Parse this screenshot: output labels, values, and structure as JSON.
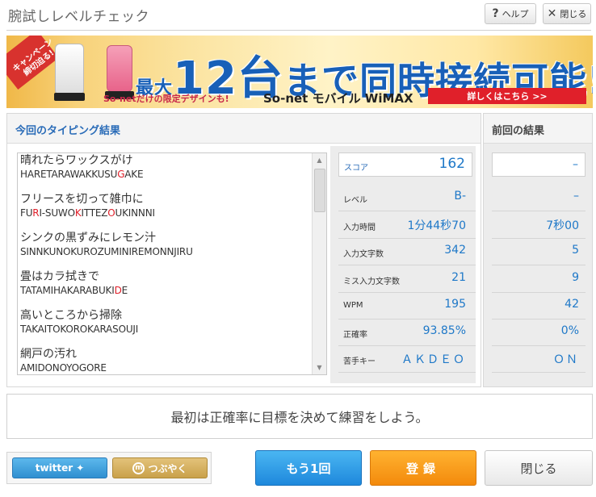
{
  "header": {
    "title": "腕試しレベルチェック",
    "help_label": "ヘルプ",
    "close_label": "閉じる"
  },
  "banner": {
    "ribbon": "キャンペーン 締切迫る!",
    "headline_pre": "最大",
    "headline_num": "12台",
    "headline_post": "まで同時接続可能!!",
    "sub": "So-netだけの限定デザインも!",
    "brand": "So-net モバイル WiMAX",
    "cta": "詳しくはこちら >>"
  },
  "current": {
    "title": "今回のタイピング結果",
    "lines": [
      {
        "jp": "晴れたらワックスがけ",
        "romaji_parts": [
          {
            "t": "HARETARAWAKKUSU",
            "err": false
          },
          {
            "t": "G",
            "err": true
          },
          {
            "t": "AKE",
            "err": false
          }
        ]
      },
      {
        "jp": "フリースを切って雑巾に",
        "romaji_parts": [
          {
            "t": "FU",
            "err": false
          },
          {
            "t": "R",
            "err": true
          },
          {
            "t": "I-SUWO",
            "err": false
          },
          {
            "t": "K",
            "err": true
          },
          {
            "t": "ITTEZ",
            "err": false
          },
          {
            "t": "O",
            "err": true
          },
          {
            "t": "UKINNNI",
            "err": false
          }
        ]
      },
      {
        "jp": "シンクの黒ずみにレモン汁",
        "romaji_parts": [
          {
            "t": "SINNKUNOKUROZUMINIREMONNJIRU",
            "err": false
          }
        ]
      },
      {
        "jp": "畳はカラ拭きで",
        "romaji_parts": [
          {
            "t": "TATAMIHAKARABUKI",
            "err": false
          },
          {
            "t": "D",
            "err": true
          },
          {
            "t": "E",
            "err": false
          }
        ]
      },
      {
        "jp": "高いところから掃除",
        "romaji_parts": [
          {
            "t": "TAKAITOKOROKARASOUJI",
            "err": false
          }
        ]
      },
      {
        "jp": "網戸の汚れ",
        "romaji_parts": [
          {
            "t": "AMIDONOYOGORE",
            "err": false
          }
        ]
      }
    ],
    "stats": {
      "score_label": "スコア",
      "score": "162",
      "level_label": "レベル",
      "level": "B-",
      "time_label": "入力時間",
      "time": "1分44秒70",
      "chars_label": "入力文字数",
      "chars": "342",
      "miss_label": "ミス入力文字数",
      "miss": "21",
      "wpm_label": "WPM",
      "wpm": "195",
      "accuracy_label": "正確率",
      "accuracy": "93.85%",
      "weak_label": "苦手キー",
      "weak": "ＡＫＤＥＯ"
    }
  },
  "previous": {
    "title": "前回の結果",
    "score": "–",
    "level": "–",
    "time": "7秒00",
    "chars": "5",
    "miss": "9",
    "wpm": "42",
    "accuracy": "0%",
    "weak": "ＯＮ"
  },
  "advice": "最初は正確率に目標を決めて練習をしよう。",
  "buttons": {
    "twitter": "twitter",
    "tsubuyaku": "つぶやく",
    "retry": "もう1回",
    "register": "登録",
    "close": "閉じる"
  },
  "colors": {
    "accent_blue": "#1e78c8",
    "error_red": "#e0202a",
    "register_orange": "#f38a0c"
  }
}
